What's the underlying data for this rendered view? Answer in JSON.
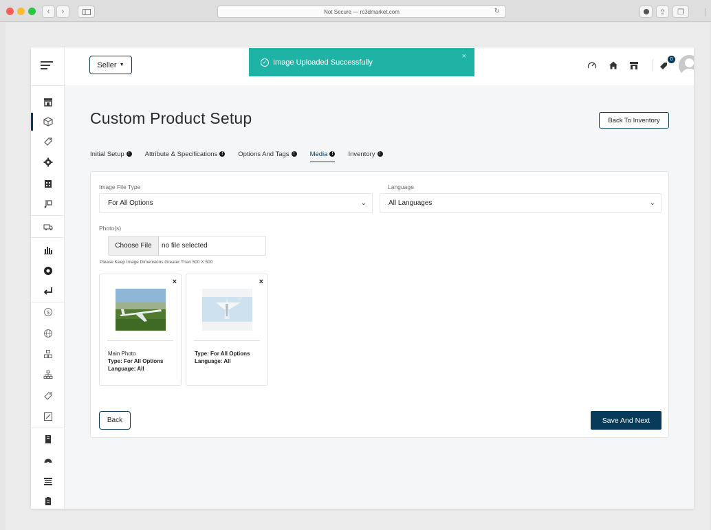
{
  "browser": {
    "address": "Not Secure — rc3dmarket.com"
  },
  "topbar": {
    "seller_label": "Seller",
    "cart_count": "0"
  },
  "toast": {
    "message": "Image Uploaded Successfully",
    "close": "×"
  },
  "page": {
    "title": "Custom Product Setup",
    "back_to_inventory": "Back To Inventory"
  },
  "tabs": [
    {
      "label": "Initial Setup"
    },
    {
      "label": "Attribute & Specifications"
    },
    {
      "label": "Options And Tags"
    },
    {
      "label": "Media"
    },
    {
      "label": "Inventory"
    }
  ],
  "active_tab": "Media",
  "form": {
    "image_file_type": {
      "label": "Image File Type",
      "value": "For All Options"
    },
    "language": {
      "label": "Language",
      "value": "All Languages"
    },
    "photos": {
      "label": "Photo(s)",
      "choose_file": "Choose File",
      "status": "no file selected",
      "hint": "Please Keep Image Dimensions Greater Than 500 X 500"
    }
  },
  "photo_cards": [
    {
      "title": "Main Photo",
      "type": "Type: For All Options",
      "language": "Language: All"
    },
    {
      "title": "",
      "type": "Type: For All Options",
      "language": "Language: All"
    }
  ],
  "buttons": {
    "back": "Back",
    "save_next": "Save And Next"
  },
  "colors": {
    "primary": "#083a5a",
    "toast": "#1fb3a6"
  }
}
